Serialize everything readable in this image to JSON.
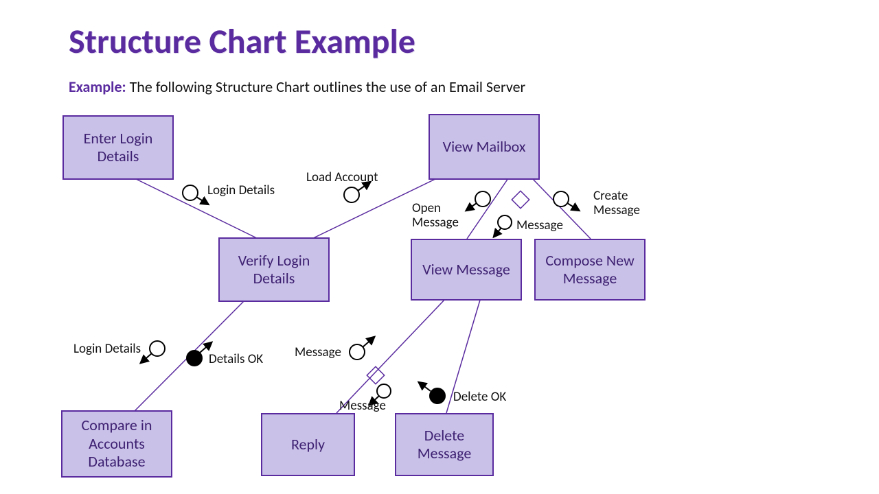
{
  "title": "Structure Chart Example",
  "subtitle_lead": "Example:",
  "subtitle_text": " The following Structure Chart outlines the use of an Email Server",
  "nodes": {
    "enter_login": "Enter Login Details",
    "verify_login": "Verify Login Details",
    "compare_db": "Compare in Accounts Database",
    "view_mailbox": "View Mailbox",
    "view_message": "View Message",
    "compose_new": "Compose New Message",
    "reply": "Reply",
    "delete_msg": "Delete Message"
  },
  "labels": {
    "login_details_top": "Login Details",
    "load_account": "Load Account",
    "open_message": "Open Message",
    "create_message": "Create Message",
    "message_mailbox": "Message",
    "login_details_bottom": "Login Details",
    "details_ok": "Details OK",
    "message_vm": "Message",
    "message_reply": "Message",
    "delete_ok": "Delete OK"
  },
  "chart_data": {
    "type": "structure-chart",
    "title": "Structure Chart Example — Email Server",
    "modules": [
      {
        "id": "enter_login",
        "label": "Enter Login Details"
      },
      {
        "id": "verify_login",
        "label": "Verify Login Details"
      },
      {
        "id": "compare_db",
        "label": "Compare in Accounts Database"
      },
      {
        "id": "view_mailbox",
        "label": "View Mailbox"
      },
      {
        "id": "view_message",
        "label": "View Message"
      },
      {
        "id": "compose_new",
        "label": "Compose New Message"
      },
      {
        "id": "reply",
        "label": "Reply"
      },
      {
        "id": "delete_msg",
        "label": "Delete Message"
      }
    ],
    "hierarchy_edges": [
      {
        "from": "enter_login",
        "to": "verify_login"
      },
      {
        "from": "view_mailbox",
        "to": "verify_login"
      },
      {
        "from": "view_mailbox",
        "to": "view_message",
        "selection": true
      },
      {
        "from": "view_mailbox",
        "to": "compose_new",
        "selection": true
      },
      {
        "from": "verify_login",
        "to": "compare_db"
      },
      {
        "from": "view_message",
        "to": "reply",
        "selection": true
      },
      {
        "from": "view_message",
        "to": "delete_msg",
        "selection": true
      }
    ],
    "couples": [
      {
        "edge": [
          "enter_login",
          "verify_login"
        ],
        "label": "Login Details",
        "kind": "data",
        "direction": "down"
      },
      {
        "edge": [
          "view_mailbox",
          "verify_login"
        ],
        "label": "Load Account",
        "kind": "data",
        "direction": "up"
      },
      {
        "edge": [
          "view_mailbox",
          "view_message"
        ],
        "label": "Open Message",
        "kind": "data",
        "direction": "down"
      },
      {
        "edge": [
          "view_mailbox",
          "view_message"
        ],
        "label": "Message",
        "kind": "data",
        "direction": "down"
      },
      {
        "edge": [
          "view_mailbox",
          "compose_new"
        ],
        "label": "Create Message",
        "kind": "data",
        "direction": "down"
      },
      {
        "edge": [
          "verify_login",
          "compare_db"
        ],
        "label": "Login Details",
        "kind": "data",
        "direction": "down"
      },
      {
        "edge": [
          "verify_login",
          "compare_db"
        ],
        "label": "Details OK",
        "kind": "control",
        "direction": "up"
      },
      {
        "edge": [
          "view_message",
          "reply"
        ],
        "label": "Message",
        "kind": "data",
        "direction": "down"
      },
      {
        "edge": [
          "view_message",
          "reply"
        ],
        "label": "Message",
        "kind": "data",
        "direction": "down"
      },
      {
        "edge": [
          "view_message",
          "delete_msg"
        ],
        "label": "Delete OK",
        "kind": "control",
        "direction": "up"
      }
    ]
  }
}
